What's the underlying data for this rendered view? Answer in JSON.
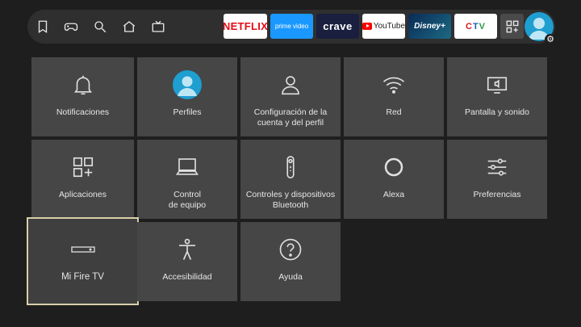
{
  "nav": {
    "icons": [
      "bookmark-icon",
      "gamepad-icon",
      "search-icon",
      "home-icon",
      "live-tv-icon"
    ]
  },
  "apps": {
    "netflix": "NETFLIX",
    "prime": "prime video",
    "crave": "crave",
    "youtube": "YouTube",
    "disney": "Disney+",
    "ctv": [
      "C",
      "T",
      "V"
    ],
    "more_icon": "apps-grid-icon"
  },
  "profile": {
    "avatar_icon": "profile-avatar-icon",
    "settings_badge": "⚙"
  },
  "colors": {
    "accent_focus": "#d8cfa8",
    "profile_blue": "#1f9ed0",
    "tile_bg": "#464646",
    "page_bg": "#1e1e1e"
  },
  "tiles": [
    {
      "label": "Notificaciones",
      "icon": "bell-icon"
    },
    {
      "label": "Perfiles",
      "icon": "profile-icon"
    },
    {
      "label": "Configuración de la\ncuenta y del perfil",
      "icon": "person-icon"
    },
    {
      "label": "Red",
      "icon": "wifi-icon"
    },
    {
      "label": "Pantalla y sonido",
      "icon": "display-sound-icon"
    },
    {
      "label": "Aplicaciones",
      "icon": "apps-icon"
    },
    {
      "label": "Control\nde equipo",
      "icon": "laptop-icon"
    },
    {
      "label": "Controles y dispositivos\nBluetooth",
      "icon": "remote-icon"
    },
    {
      "label": "Alexa",
      "icon": "alexa-icon"
    },
    {
      "label": "Preferencias",
      "icon": "sliders-icon"
    },
    {
      "label": "Mi Fire TV",
      "icon": "fire-tv-device-icon",
      "focused": true
    },
    {
      "label": "Accesibilidad",
      "icon": "accessibility-icon"
    },
    {
      "label": "Ayuda",
      "icon": "help-icon"
    }
  ]
}
